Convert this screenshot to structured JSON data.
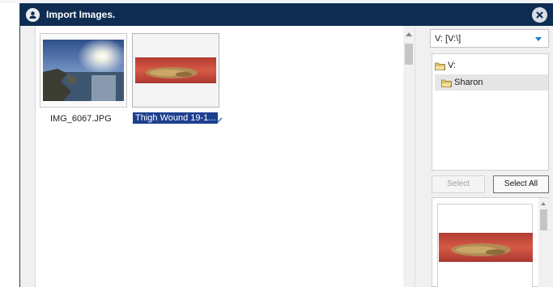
{
  "window": {
    "title": "Import Images.",
    "user_icon": "user-icon",
    "close_icon": "close-icon"
  },
  "images": [
    {
      "caption": "IMG_6067.JPG",
      "selected": false
    },
    {
      "caption": "Thigh Wound 19-1...",
      "selected": true
    }
  ],
  "drive_select": {
    "value": "V: [V:\\]"
  },
  "folder_tree": [
    {
      "label": "V:",
      "selected": false,
      "icon": "folder-icon"
    },
    {
      "label": "Sharon",
      "selected": true,
      "icon": "folder-icon"
    }
  ],
  "buttons": {
    "select": {
      "label": "Select",
      "enabled": false
    },
    "select_all": {
      "label": "Select All",
      "enabled": true
    }
  },
  "colors": {
    "title_bar": "#0f2d52",
    "selection": "#1d3f8f",
    "dropdown_accent": "#1a7bd6"
  }
}
